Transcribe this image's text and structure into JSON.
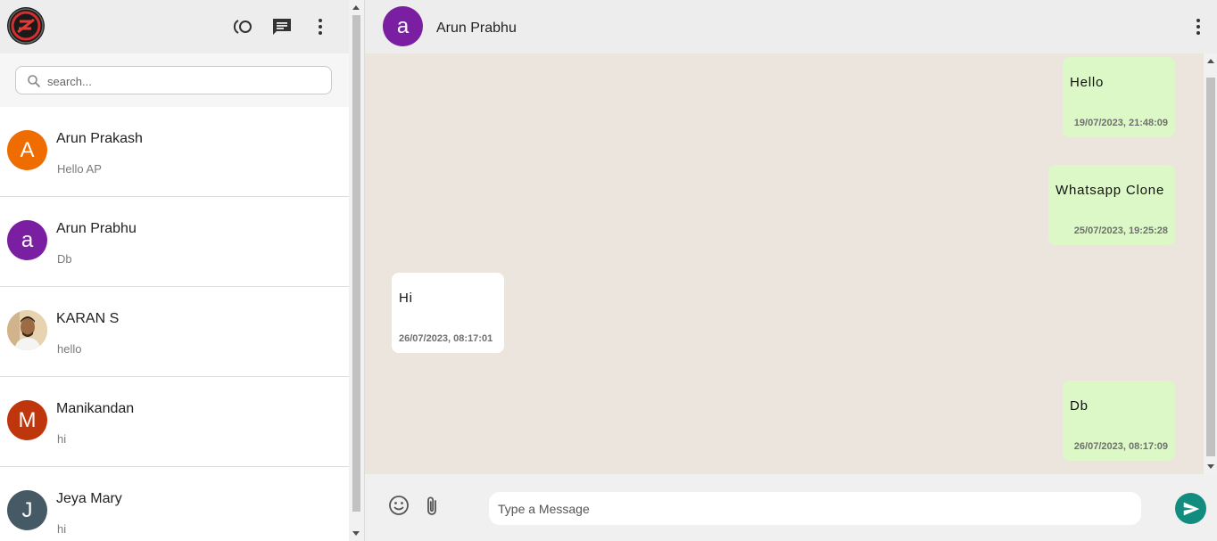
{
  "sidebar": {
    "search": {
      "placeholder": "search...",
      "value": ""
    },
    "chats": [
      {
        "avatar_letter": "A",
        "avatar_color": "#ef6c00",
        "name": "Arun Prakash",
        "last_message": "Hello AP"
      },
      {
        "avatar_letter": "a",
        "avatar_color": "#7b1fa2",
        "name": "Arun Prabhu",
        "last_message": "Db"
      },
      {
        "avatar_letter": "",
        "avatar_color": "#d9b98e",
        "name": "KARAN S",
        "last_message": "hello"
      },
      {
        "avatar_letter": "M",
        "avatar_color": "#bf360c",
        "name": "Manikandan",
        "last_message": "hi"
      },
      {
        "avatar_letter": "J",
        "avatar_color": "#455a64",
        "name": "Jeya Mary",
        "last_message": "hi"
      }
    ]
  },
  "conversation": {
    "contact": {
      "avatar_letter": "a",
      "avatar_color": "#7b1fa2",
      "name": "Arun Prabhu"
    },
    "messages": [
      {
        "direction": "sent",
        "text": "Hello",
        "time": "19/07/2023, 21:48:09"
      },
      {
        "direction": "sent",
        "text": "Whatsapp Clone",
        "time": "25/07/2023, 19:25:28"
      },
      {
        "direction": "received",
        "text": "Hi",
        "time": "26/07/2023, 08:17:01"
      },
      {
        "direction": "sent",
        "text": "Db",
        "time": "26/07/2023, 08:17:09"
      }
    ],
    "composer": {
      "placeholder": "Type a Message",
      "value": ""
    }
  },
  "colors": {
    "header_bg": "#ededed",
    "chat_bg": "#ece5dd",
    "sent_bubble": "#dcf8c6",
    "received_bubble": "#ffffff",
    "send_button": "#128c7e"
  },
  "icons": {
    "header": [
      "status-icon",
      "new-chat-icon",
      "more-vert-icon"
    ],
    "search": "search-icon",
    "footer": [
      "emoji-icon",
      "attach-icon",
      "send-icon"
    ]
  }
}
